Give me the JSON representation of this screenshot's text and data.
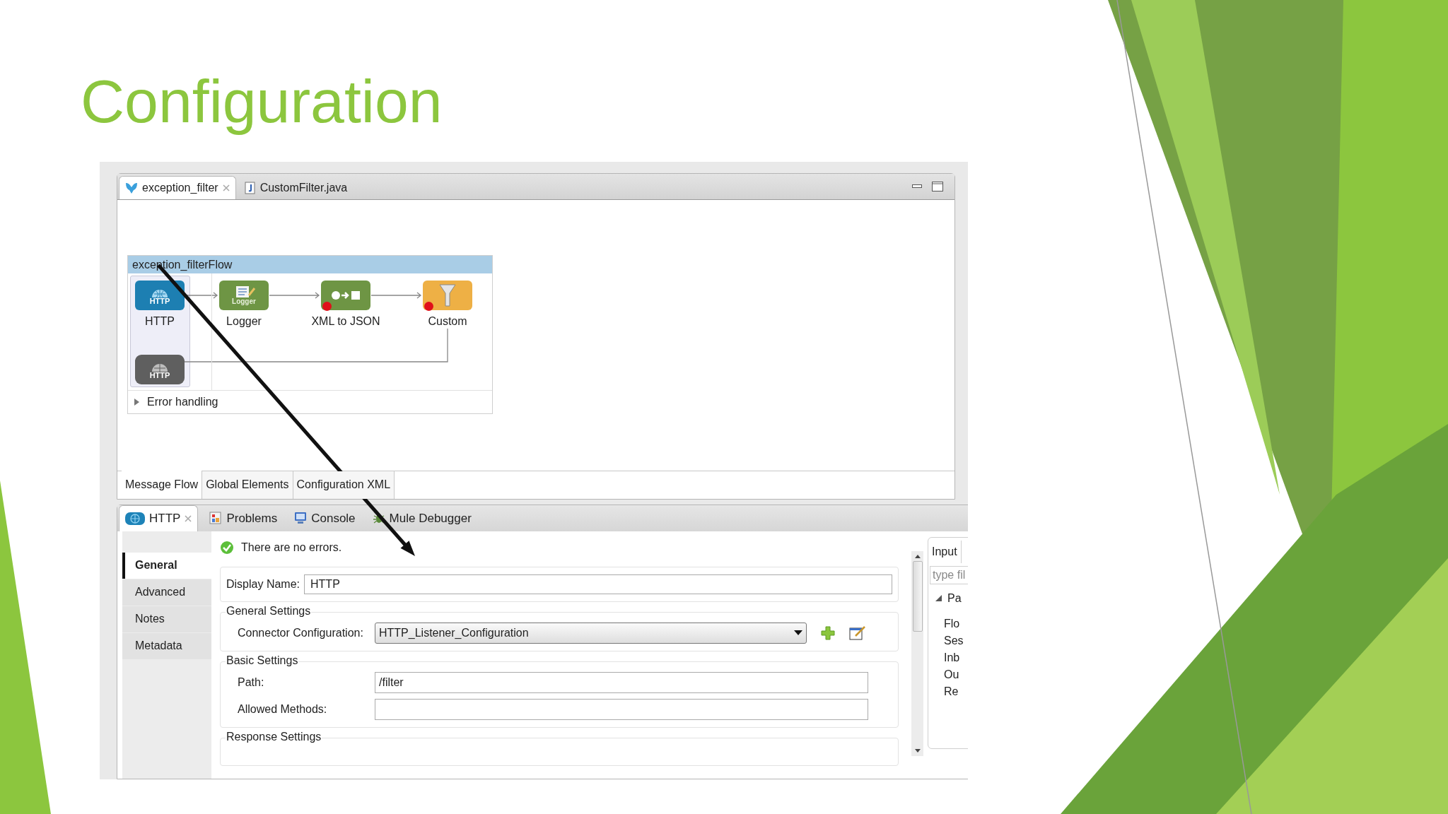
{
  "slide": {
    "title": "Configuration"
  },
  "editor": {
    "tabs": [
      {
        "label": "exception_filter",
        "selected": true,
        "closable": true,
        "kind": "flow"
      },
      {
        "label": "CustomFilter.java",
        "selected": false,
        "closable": false,
        "kind": "java"
      }
    ],
    "flow": {
      "name": "exception_filterFlow",
      "nodes": [
        {
          "label": "HTTP",
          "kind": "source",
          "icon_text": "HTTP",
          "breakpoint": false
        },
        {
          "label": "Logger",
          "kind": "logger",
          "icon_text": "Logger",
          "breakpoint": false
        },
        {
          "label": "XML to JSON",
          "kind": "transformer",
          "breakpoint": true
        },
        {
          "label": "Custom",
          "kind": "filter",
          "breakpoint": true
        }
      ],
      "response_icon_text": "HTTP",
      "error_handling": {
        "label": "Error handling",
        "expanded": false
      }
    },
    "view_tabs": [
      {
        "label": "Message Flow",
        "selected": true
      },
      {
        "label": "Global Elements",
        "selected": false
      },
      {
        "label": "Configuration XML",
        "selected": false
      }
    ]
  },
  "properties": {
    "tabs": [
      {
        "label": "HTTP",
        "selected": true,
        "closable": true,
        "kind": "http"
      },
      {
        "label": "Problems",
        "selected": false,
        "closable": false,
        "kind": "problems"
      },
      {
        "label": "Console",
        "selected": false,
        "closable": false,
        "kind": "console"
      },
      {
        "label": "Mule Debugger",
        "selected": false,
        "closable": false,
        "kind": "debugger"
      }
    ],
    "nav": [
      {
        "label": "General",
        "selected": true
      },
      {
        "label": "Advanced",
        "selected": false
      },
      {
        "label": "Notes",
        "selected": false
      },
      {
        "label": "Metadata",
        "selected": false
      }
    ],
    "status": "There are no errors.",
    "display_name": {
      "label": "Display Name:",
      "value": "HTTP"
    },
    "groups": [
      {
        "title": "General Settings",
        "fields": [
          {
            "kind": "select",
            "label": "Connector Configuration:",
            "value": "HTTP_Listener_Configuration"
          }
        ]
      },
      {
        "title": "Basic Settings",
        "fields": [
          {
            "kind": "text",
            "label": "Path:",
            "value": "/filter"
          },
          {
            "kind": "text",
            "label": "Allowed Methods:"
          }
        ]
      },
      {
        "title": "Response Settings"
      }
    ],
    "metadata": {
      "tab": "Input",
      "placeholder": "type fil",
      "tree": [
        {
          "label": "Pa",
          "expanded": true,
          "children": [
            {
              "label": "Flo"
            },
            {
              "label": "Ses"
            },
            {
              "label": "Inb"
            },
            {
              "label": "Ou"
            },
            {
              "label": "Re"
            }
          ]
        }
      ]
    }
  }
}
